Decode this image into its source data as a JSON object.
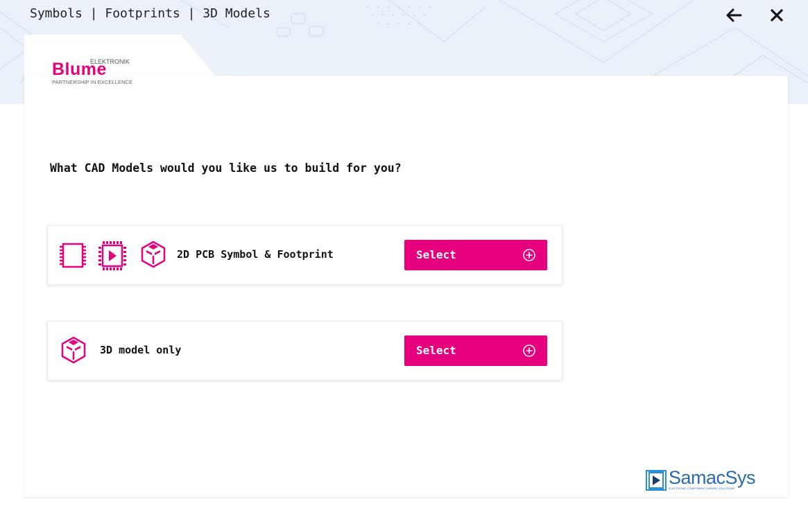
{
  "header": {
    "title": "Symbols | Footprints | 3D Models",
    "back_icon": "arrow-left-icon",
    "close_icon": "close-icon"
  },
  "logo": {
    "brand": "Blume",
    "top_text": "ELEKTRONIK",
    "tagline": "PARTNERSHIP IN EXCELLENCE"
  },
  "question": "What CAD Models would you like us to build for you?",
  "options": [
    {
      "label": "2D PCB Symbol & Footprint",
      "icons": [
        "symbol-icon",
        "footprint-icon",
        "3d-model-icon"
      ],
      "button_label": "Select",
      "button_icon": "plus-circle-icon"
    },
    {
      "label": "3D model only",
      "icons": [
        "3d-model-icon"
      ],
      "button_label": "Select",
      "button_icon": "plus-circle-icon"
    }
  ],
  "footer": {
    "logo_text": "SamacSys",
    "logo_subtext": "ELECTRONIC COMPONENT LIBRARY SOLUTIONS"
  },
  "colors": {
    "accent": "#e6007e",
    "banner_bg": "#eaf1f8",
    "samacsys_blue": "#2a6aa8"
  }
}
